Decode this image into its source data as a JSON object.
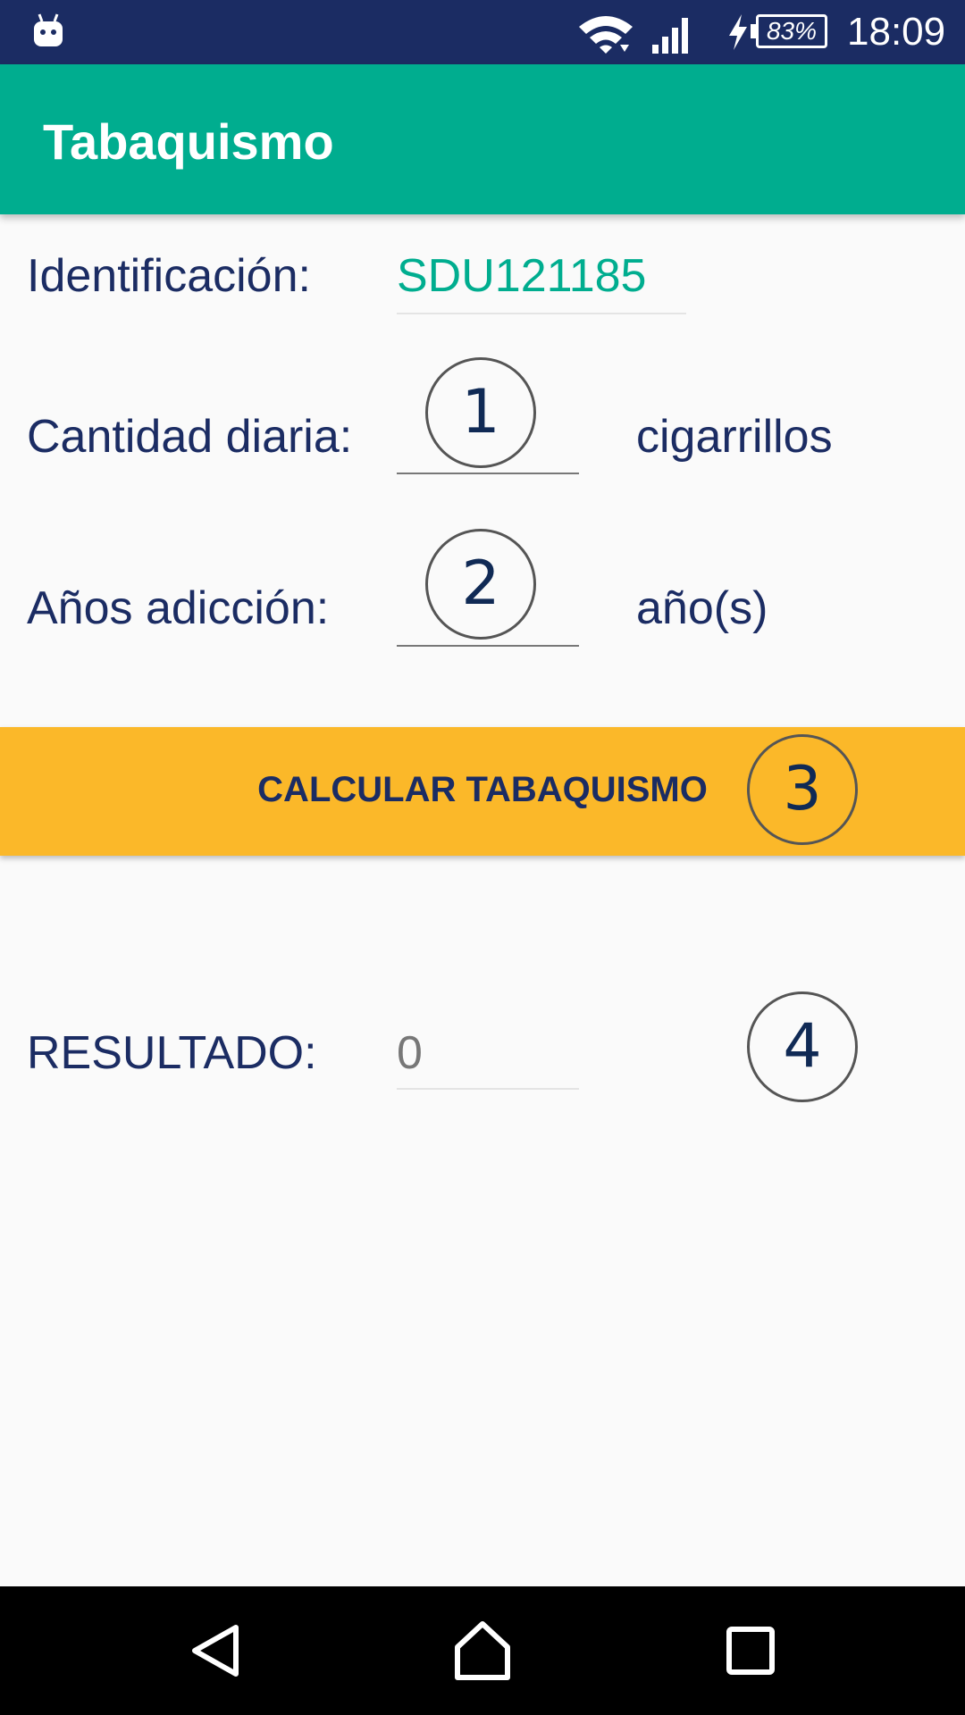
{
  "status_bar": {
    "battery": "83%",
    "time": "18:09",
    "icons": [
      "android-notification-icon",
      "wifi-icon",
      "cell-signal-icon",
      "charging-bolt-icon",
      "battery-icon"
    ]
  },
  "app_bar": {
    "title": "Tabaquismo"
  },
  "form": {
    "identificacion_label": "Identificación:",
    "identificacion_value": "SDU121185",
    "cantidad_label": "Cantidad diaria:",
    "cantidad_value": "",
    "cantidad_unit": "cigarrillos",
    "anos_label": "Años adicción:",
    "anos_value": "",
    "anos_unit": "año(s)",
    "calc_button_label": "CALCULAR TABAQUISMO",
    "resultado_label": "RESULTADO:",
    "resultado_value": "0"
  },
  "annotations": {
    "marker_1": "1",
    "marker_2": "2",
    "marker_3": "3",
    "marker_4": "4"
  },
  "nav_bar": {
    "icons": [
      "back-icon",
      "home-icon",
      "recents-icon"
    ]
  },
  "colors": {
    "status_bar": "#1b2c63",
    "app_bar": "#00ad8f",
    "accent_text": "#00ad8f",
    "label_text": "#1b2c63",
    "button": "#fbb829",
    "nav_bar": "#000000"
  }
}
